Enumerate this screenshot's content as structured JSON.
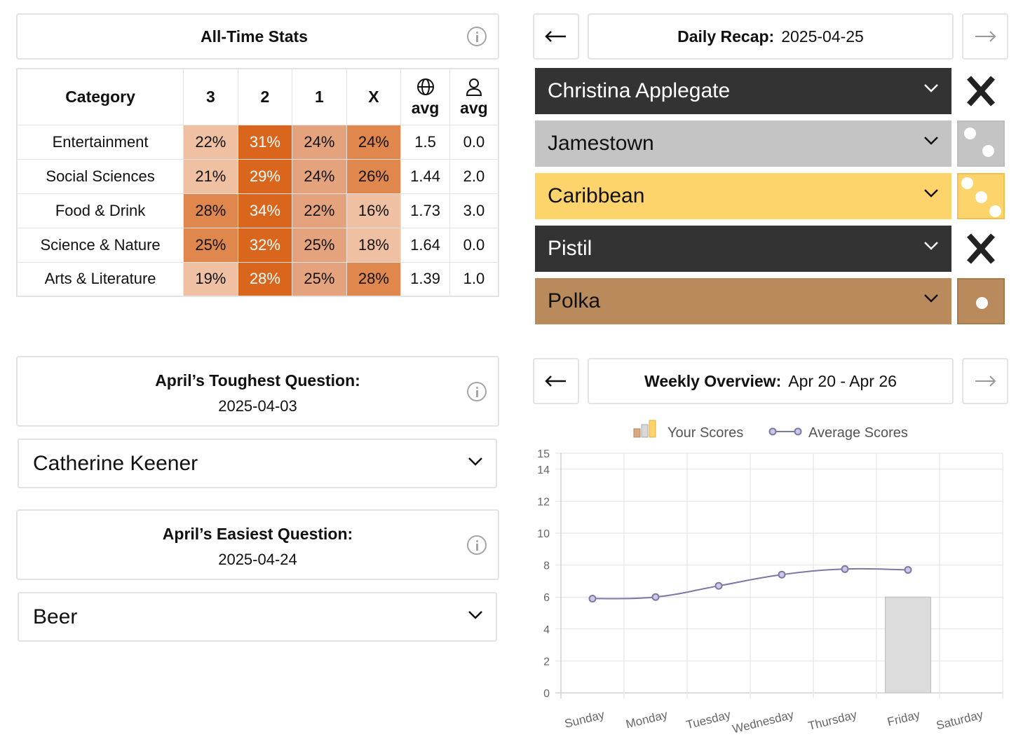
{
  "all_time": {
    "title": "All-Time Stats",
    "headers": {
      "category": "Category",
      "c3": "3",
      "c2": "2",
      "c1": "1",
      "cx": "X",
      "global_avg": "avg",
      "user_avg": "avg"
    },
    "rows": [
      {
        "category": "Entertainment",
        "c3": "22%",
        "c2": "31%",
        "c1": "24%",
        "cx": "24%",
        "global_avg": "1.5",
        "user_avg": "0.0"
      },
      {
        "category": "Social Sciences",
        "c3": "21%",
        "c2": "29%",
        "c1": "24%",
        "cx": "26%",
        "global_avg": "1.44",
        "user_avg": "2.0"
      },
      {
        "category": "Food & Drink",
        "c3": "28%",
        "c2": "34%",
        "c1": "22%",
        "cx": "16%",
        "global_avg": "1.73",
        "user_avg": "3.0"
      },
      {
        "category": "Science & Nature",
        "c3": "25%",
        "c2": "32%",
        "c1": "25%",
        "cx": "18%",
        "global_avg": "1.64",
        "user_avg": "0.0"
      },
      {
        "category": "Arts & Literature",
        "c3": "19%",
        "c2": "28%",
        "c1": "25%",
        "cx": "28%",
        "global_avg": "1.39",
        "user_avg": "1.0"
      }
    ],
    "cell_colors": [
      [
        "#efc0a2",
        "#d9661c",
        "#e4a37c",
        "#e0874d"
      ],
      [
        "#efc0a2",
        "#d9661c",
        "#e4a37c",
        "#e0874d"
      ],
      [
        "#e0874d",
        "#d9661c",
        "#e4a37c",
        "#efc0a2"
      ],
      [
        "#e0874d",
        "#d9661c",
        "#e4a37c",
        "#efc0a2"
      ],
      [
        "#efc0a2",
        "#d9661c",
        "#e4a37c",
        "#e0874d"
      ]
    ]
  },
  "daily": {
    "label": "Daily Recap:",
    "date": "2025-04-25",
    "prev_icon": "arrow-left-icon",
    "next_icon": "arrow-right-icon",
    "answers": [
      {
        "text": "Christina Applegate",
        "bg": "#333333",
        "fg": "#ffffff",
        "result": "X"
      },
      {
        "text": "Jamestown",
        "bg": "#c4c4c4",
        "fg": "#111111",
        "result": "2"
      },
      {
        "text": "Caribbean",
        "bg": "#fdd36c",
        "fg": "#111111",
        "result": "3"
      },
      {
        "text": "Pistil",
        "bg": "#333333",
        "fg": "#ffffff",
        "result": "X"
      },
      {
        "text": "Polka",
        "bg": "#b98b5c",
        "fg": "#111111",
        "result": "1"
      }
    ]
  },
  "toughest": {
    "title": "April’s Toughest Question:",
    "date": "2025-04-03",
    "answer": "Catherine Keener"
  },
  "easiest": {
    "title": "April’s Easiest Question:",
    "date": "2025-04-24",
    "answer": "Beer"
  },
  "weekly": {
    "label": "Weekly Overview:",
    "range": "Apr 20 - Apr 26",
    "legend_yours": "Your Scores",
    "legend_avg": "Average Scores"
  },
  "chart_data": {
    "type": "bar",
    "categories": [
      "Sunday",
      "Monday",
      "Tuesday",
      "Wednesday",
      "Thursday",
      "Friday",
      "Saturday"
    ],
    "series": [
      {
        "name": "Your Scores",
        "type": "bar",
        "values": [
          null,
          null,
          null,
          null,
          null,
          6,
          null
        ]
      },
      {
        "name": "Average Scores",
        "type": "line",
        "values": [
          5.9,
          6.0,
          6.7,
          7.4,
          7.75,
          7.7,
          null
        ]
      }
    ],
    "ylim": [
      0,
      15
    ],
    "yticks": [
      0,
      2,
      4,
      6,
      8,
      10,
      12,
      14,
      15
    ],
    "grid": true,
    "legend": "top",
    "colors": {
      "bar": "#dcdcdc",
      "bar_border": "#b8b8b8",
      "line": "#7b78a6",
      "grid": "#e2e2e2"
    }
  }
}
